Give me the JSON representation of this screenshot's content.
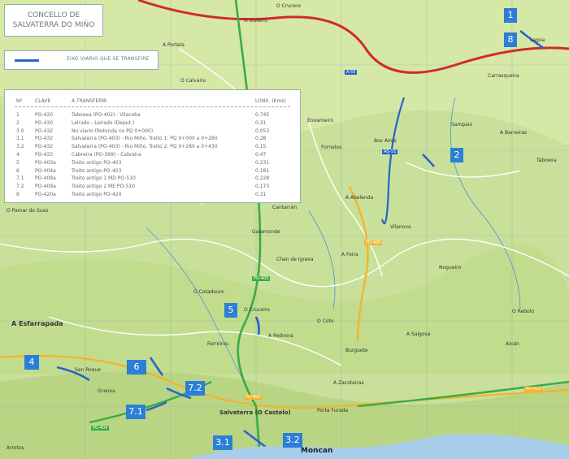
{
  "title": "CONCELLO DE SALVATERRA DO MIÑO",
  "legend": {
    "label": "EIXO VIARIO QUE SE TRANSFIRE",
    "color": "#2a63c9"
  },
  "table": {
    "headers": [
      "Nº",
      "CLAVE",
      "A TRANSFERIR",
      "LONX. (Kms)"
    ],
    "rows": [
      [
        "1",
        "PO-420",
        "Taboexa (PO-402) - Vilacoba",
        "0,745"
      ],
      [
        "2",
        "PO-430",
        "Leirado - Leirado (Deput.)",
        "0,31"
      ],
      [
        "3.0",
        "PO-432",
        "No viario (Rotonda no PQ 0+000)",
        "0,053"
      ],
      [
        "3.1",
        "PO-432",
        "Salvaterra (PO-403) - Rio Miño. Treito 1: PQ 0+000 a 0+280",
        "0,28"
      ],
      [
        "3.2",
        "PO-432",
        "Salvaterra (PO-403) - Rio Miño. Treito 2: PQ 0+280 a 0+430",
        "0,15"
      ],
      [
        "4",
        "PO-433",
        "Cabreira (PO-399) - Cabreira",
        "0,47"
      ],
      [
        "5",
        "PO-403a",
        "Treito antigo PO-403",
        "0,231"
      ],
      [
        "6",
        "PO-404a",
        "Treito antigo PO-403",
        "0,181"
      ],
      [
        "7.1",
        "PO-409a",
        "Treito antigo 1 MD PO-510",
        "0,228"
      ],
      [
        "7.2",
        "PO-409a",
        "Treito antigo 2 ME PO-510",
        "0,173"
      ],
      [
        "8",
        "PO-420a",
        "Treito antigo PO-420",
        "0,31"
      ]
    ]
  },
  "markers": [
    "1",
    "8",
    "2",
    "5",
    "4",
    "6",
    "7.2",
    "7.1",
    "3.1",
    "3.2"
  ],
  "roads": [
    "A-55",
    "AG-51",
    "PO-403",
    "PO-404",
    "PO-400",
    "PO-415",
    "PO-402"
  ],
  "places": [
    "O Crucero",
    "O Outeiro",
    "A Portela",
    "O Calvario",
    "Lagoa",
    "Carrasqueira",
    "Enxameiro",
    "Sampaio",
    "Fornelos",
    "A Abelenda",
    "Bos Aires",
    "Vilanova",
    "Cantarrán",
    "O Pamar de Suso",
    "A Barreiras",
    "Galamonde",
    "Chan de Igrexa",
    "A Feira",
    "O Coto",
    "Nogueiro",
    "O Cotadouro",
    "A Esfarrapada",
    "O Cruceiro",
    "A Pedreira",
    "Ferreiros",
    "Burguete",
    "A Salgosa",
    "San Roque",
    "Granxa",
    "Salvaterra (O Castelo)",
    "A Zacoteiras",
    "Porta Furada",
    "Moncan",
    "Arrotos",
    "O Rebolo",
    "Taboexa",
    "Alxán"
  ]
}
